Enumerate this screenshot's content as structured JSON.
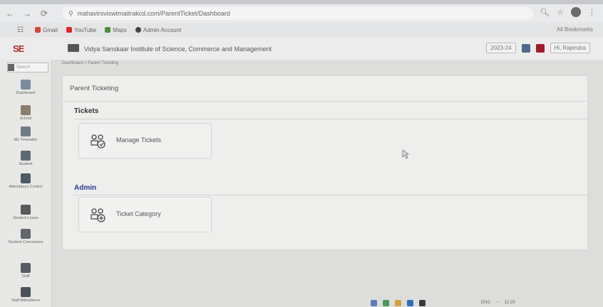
{
  "browser": {
    "url": "mahavirsviswtmaitrakcd.com/ParentTicket/Dashboard",
    "bookmarks": [
      {
        "label": "Gmail",
        "color": "#d44638"
      },
      {
        "label": "YouTube",
        "color": "#e02a2a"
      },
      {
        "label": "Maps",
        "color": "#4a8f3a"
      },
      {
        "label": "Admin Account",
        "color": "#444444"
      }
    ],
    "all_bookmarks": "All Bookmarks"
  },
  "header": {
    "logo": "SE",
    "institute": "Vidya Sanskaar Institute of Science, Commerce and Management",
    "session": "2023-24",
    "user": "Hi, Rajendra"
  },
  "sidebar": {
    "search_placeholder": "Search",
    "items": [
      {
        "label": "Dashboard"
      },
      {
        "label": "School"
      },
      {
        "label": "My Timetable"
      },
      {
        "label": "Student"
      },
      {
        "label": "Attendance Control"
      },
      {
        "label": "Student Leave"
      },
      {
        "label": "Student Concession"
      },
      {
        "label": "Staff"
      },
      {
        "label": "Staff Attendance"
      }
    ]
  },
  "breadcrumb": "Dashboard > Parent Ticketing",
  "page": {
    "title": "Parent Ticketing",
    "sections": [
      {
        "title": "Tickets",
        "tiles": [
          {
            "label": "Manage Tickets"
          }
        ]
      },
      {
        "title": "Admin",
        "tiles": [
          {
            "label": "Ticket Category"
          }
        ]
      }
    ]
  },
  "taskbar": {
    "lang": "ENG",
    "time": "12:20"
  },
  "colors": {
    "admin_heading": "#2b3a8f",
    "logo": "#b32a2a"
  }
}
